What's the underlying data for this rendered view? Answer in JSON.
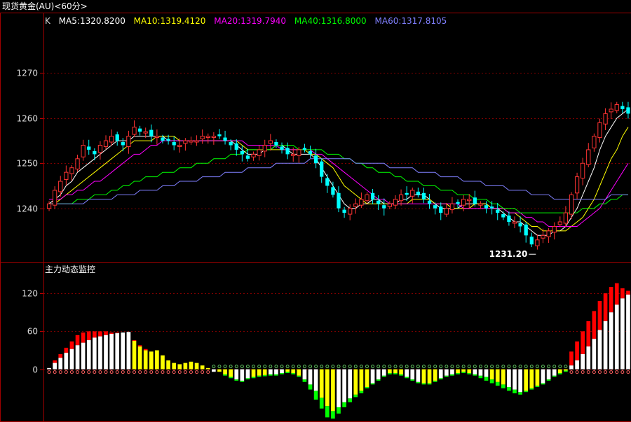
{
  "title": "现货黄金(AU)<60分>",
  "ma_legend": {
    "k_label": "K",
    "items": [
      {
        "label": "MA5:1320.8200",
        "color": "#ffffff"
      },
      {
        "label": "MA10:1319.4120",
        "color": "#ffff00"
      },
      {
        "label": "MA20:1319.7940",
        "color": "#ff00ff"
      },
      {
        "label": "MA40:1316.8000",
        "color": "#00ff00"
      },
      {
        "label": "MA60:1317.8105",
        "color": "#8080ff"
      }
    ]
  },
  "sub_title": "主力动态监控",
  "colors": {
    "up": "#ff3333",
    "down": "#00ffff",
    "frame": "#a00000",
    "grid": "#800000",
    "red_bar": "#ff0000",
    "white_bar": "#ffffff",
    "yellow_bar": "#ffff00",
    "green_bar": "#00ff00"
  },
  "chart_data": [
    {
      "type": "candlestick",
      "ylim": [
        1228,
        1280
      ],
      "yticks": [
        1240,
        1250,
        1260,
        1270
      ],
      "annotation": "1231.20",
      "closes": [
        1241,
        1244,
        1246,
        1248,
        1249,
        1251,
        1254,
        1253,
        1252,
        1254,
        1255,
        1256,
        1255,
        1254,
        1256,
        1258,
        1257,
        1257,
        1256,
        1256,
        1255,
        1255,
        1254,
        1254,
        1255,
        1255,
        1255,
        1256,
        1256,
        1256,
        1256,
        1255,
        1254,
        1253,
        1252,
        1251,
        1252,
        1253,
        1254,
        1255,
        1254,
        1253,
        1252,
        1252,
        1253,
        1253,
        1252,
        1250,
        1247,
        1245,
        1243,
        1240,
        1239,
        1240,
        1241,
        1242,
        1243,
        1242,
        1241,
        1240,
        1241,
        1242,
        1243,
        1243,
        1244,
        1243,
        1242,
        1241,
        1240,
        1239,
        1240,
        1241,
        1241,
        1242,
        1242,
        1241,
        1241,
        1240,
        1240,
        1239,
        1238,
        1237,
        1237,
        1236,
        1234,
        1232,
        1233,
        1234,
        1235,
        1236,
        1237,
        1239,
        1243,
        1247,
        1250,
        1253,
        1256,
        1259,
        1261,
        1262,
        1263,
        1262,
        1261
      ],
      "series": [
        {
          "name": "MA5",
          "values": [
            1241,
            1242,
            1243,
            1245,
            1246,
            1248,
            1249,
            1250,
            1251,
            1252,
            1253,
            1254,
            1255,
            1255,
            1255,
            1256,
            1256,
            1256,
            1256,
            1256,
            1256,
            1255,
            1255,
            1255,
            1255,
            1255,
            1255,
            1255,
            1255,
            1255,
            1255,
            1255,
            1255,
            1254,
            1253,
            1252,
            1252,
            1252,
            1253,
            1253,
            1254,
            1254,
            1253,
            1252,
            1252,
            1252,
            1252,
            1251,
            1249,
            1247,
            1245,
            1243,
            1241,
            1240,
            1240,
            1241,
            1241,
            1242,
            1242,
            1241,
            1241,
            1241,
            1242,
            1242,
            1243,
            1243,
            1243,
            1242,
            1241,
            1240,
            1240,
            1240,
            1240,
            1241,
            1241,
            1241,
            1241,
            1241,
            1240,
            1240,
            1239,
            1238,
            1237,
            1237,
            1236,
            1235,
            1234,
            1234,
            1234,
            1235,
            1235,
            1236,
            1238,
            1240,
            1243,
            1246,
            1249,
            1253,
            1256,
            1258,
            1260,
            1261,
            1262
          ]
        },
        {
          "name": "MA10",
          "values": [
            1241,
            1241,
            1242,
            1243,
            1244,
            1245,
            1246,
            1247,
            1248,
            1249,
            1250,
            1251,
            1252,
            1253,
            1254,
            1255,
            1255,
            1255,
            1255,
            1256,
            1256,
            1256,
            1256,
            1255,
            1255,
            1255,
            1255,
            1255,
            1255,
            1255,
            1255,
            1255,
            1255,
            1255,
            1254,
            1253,
            1253,
            1253,
            1253,
            1253,
            1253,
            1253,
            1253,
            1253,
            1253,
            1253,
            1252,
            1252,
            1251,
            1250,
            1249,
            1247,
            1245,
            1244,
            1243,
            1242,
            1241,
            1241,
            1241,
            1241,
            1241,
            1241,
            1241,
            1241,
            1242,
            1242,
            1242,
            1242,
            1241,
            1241,
            1241,
            1240,
            1240,
            1240,
            1240,
            1241,
            1241,
            1241,
            1240,
            1240,
            1240,
            1239,
            1239,
            1238,
            1237,
            1236,
            1236,
            1235,
            1235,
            1235,
            1235,
            1235,
            1236,
            1237,
            1238,
            1240,
            1242,
            1245,
            1248,
            1251,
            1253,
            1256,
            1258
          ]
        },
        {
          "name": "MA20",
          "values": [
            1242,
            1242,
            1242,
            1243,
            1243,
            1244,
            1244,
            1245,
            1246,
            1246,
            1247,
            1248,
            1249,
            1250,
            1251,
            1252,
            1252,
            1253,
            1254,
            1254,
            1255,
            1255,
            1255,
            1255,
            1255,
            1255,
            1255,
            1255,
            1255,
            1255,
            1255,
            1255,
            1255,
            1255,
            1255,
            1254,
            1254,
            1254,
            1254,
            1254,
            1254,
            1253,
            1253,
            1253,
            1253,
            1253,
            1253,
            1252,
            1252,
            1251,
            1250,
            1249,
            1248,
            1247,
            1246,
            1245,
            1244,
            1243,
            1242,
            1242,
            1241,
            1241,
            1241,
            1241,
            1241,
            1241,
            1241,
            1241,
            1241,
            1241,
            1241,
            1241,
            1241,
            1240,
            1240,
            1240,
            1240,
            1240,
            1240,
            1240,
            1240,
            1239,
            1239,
            1239,
            1238,
            1238,
            1237,
            1237,
            1236,
            1236,
            1236,
            1236,
            1236,
            1236,
            1237,
            1238,
            1239,
            1240,
            1242,
            1244,
            1246,
            1248,
            1250
          ]
        },
        {
          "name": "MA40",
          "values": [
            1241,
            1241,
            1241,
            1241,
            1241,
            1242,
            1242,
            1242,
            1243,
            1243,
            1243,
            1244,
            1244,
            1245,
            1245,
            1246,
            1246,
            1247,
            1247,
            1247,
            1248,
            1248,
            1248,
            1249,
            1249,
            1249,
            1250,
            1250,
            1250,
            1251,
            1251,
            1251,
            1252,
            1252,
            1252,
            1253,
            1253,
            1253,
            1253,
            1253,
            1254,
            1254,
            1254,
            1254,
            1253,
            1253,
            1253,
            1253,
            1253,
            1252,
            1252,
            1252,
            1251,
            1251,
            1250,
            1250,
            1249,
            1249,
            1248,
            1248,
            1248,
            1247,
            1247,
            1246,
            1246,
            1246,
            1245,
            1245,
            1245,
            1244,
            1244,
            1244,
            1243,
            1243,
            1243,
            1242,
            1242,
            1242,
            1241,
            1241,
            1240,
            1240,
            1240,
            1239,
            1239,
            1239,
            1239,
            1239,
            1239,
            1239,
            1239,
            1239,
            1239,
            1239,
            1240,
            1240,
            1240,
            1241,
            1241,
            1242,
            1242,
            1243,
            1243
          ]
        },
        {
          "name": "MA60",
          "values": [
            1241,
            1241,
            1241,
            1241,
            1241,
            1241,
            1241,
            1242,
            1242,
            1242,
            1242,
            1242,
            1243,
            1243,
            1243,
            1243,
            1244,
            1244,
            1244,
            1244,
            1245,
            1245,
            1245,
            1246,
            1246,
            1246,
            1246,
            1247,
            1247,
            1247,
            1247,
            1248,
            1248,
            1248,
            1248,
            1249,
            1249,
            1249,
            1249,
            1249,
            1250,
            1250,
            1250,
            1250,
            1250,
            1250,
            1251,
            1251,
            1251,
            1251,
            1251,
            1251,
            1251,
            1251,
            1250,
            1250,
            1250,
            1250,
            1250,
            1250,
            1249,
            1249,
            1249,
            1249,
            1249,
            1248,
            1248,
            1248,
            1248,
            1247,
            1247,
            1247,
            1247,
            1246,
            1246,
            1246,
            1246,
            1245,
            1245,
            1245,
            1245,
            1244,
            1244,
            1244,
            1244,
            1243,
            1243,
            1243,
            1243,
            1242,
            1242,
            1242,
            1242,
            1242,
            1242,
            1242,
            1242,
            1242,
            1242,
            1243,
            1243,
            1243,
            1243
          ]
        }
      ]
    },
    {
      "type": "bar",
      "name": "主力动态监控",
      "ylim": [
        -80,
        150
      ],
      "yticks": [
        0,
        60,
        120
      ],
      "values": [
        2,
        10,
        18,
        26,
        32,
        38,
        42,
        46,
        50,
        52,
        54,
        56,
        57,
        58,
        59,
        45,
        36,
        30,
        28,
        30,
        22,
        14,
        10,
        8,
        10,
        12,
        10,
        6,
        2,
        -4,
        -4,
        -8,
        -12,
        -16,
        -18,
        -14,
        -12,
        -10,
        -9,
        -8,
        -8,
        -6,
        -4,
        -6,
        -10,
        -16,
        -24,
        -34,
        -45,
        -58,
        -66,
        -60,
        -52,
        -46,
        -40,
        -34,
        -28,
        -22,
        -16,
        -10,
        -6,
        -6,
        -8,
        -12,
        -16,
        -20,
        -22,
        -22,
        -18,
        -14,
        -10,
        -8,
        -6,
        -4,
        -6,
        -8,
        -10,
        -12,
        -16,
        -20,
        -24,
        -28,
        -32,
        -36,
        -34,
        -30,
        -26,
        -22,
        -16,
        -10,
        -6,
        -2,
        6,
        14,
        24,
        36,
        48,
        62,
        76,
        90,
        102,
        112,
        118
      ],
      "upper": [
        2,
        14,
        24,
        34,
        44,
        54,
        58,
        60,
        60,
        60,
        60,
        58,
        58,
        58,
        59,
        46,
        38,
        32,
        28,
        30,
        22,
        14,
        10,
        8,
        10,
        12,
        10,
        6,
        2,
        -4,
        -4,
        -8,
        -12,
        -16,
        -18,
        -14,
        -12,
        -10,
        -9,
        -8,
        -8,
        -6,
        -4,
        -6,
        -10,
        -16,
        -24,
        -34,
        -45,
        -58,
        -66,
        -60,
        -52,
        -46,
        -40,
        -34,
        -28,
        -22,
        -16,
        -10,
        -6,
        -6,
        -8,
        -12,
        -16,
        -20,
        -22,
        -22,
        -18,
        -14,
        -10,
        -8,
        -6,
        -4,
        -6,
        -8,
        -10,
        -12,
        -16,
        -20,
        -24,
        -28,
        -32,
        -36,
        -34,
        -30,
        -26,
        -22,
        -16,
        -10,
        -6,
        -2,
        28,
        44,
        60,
        76,
        92,
        108,
        120,
        130,
        136,
        128,
        124
      ],
      "lower_green": [
        0,
        0,
        0,
        0,
        0,
        0,
        0,
        0,
        0,
        0,
        0,
        0,
        0,
        0,
        0,
        0,
        0,
        0,
        0,
        0,
        0,
        0,
        0,
        0,
        0,
        0,
        0,
        0,
        0,
        0,
        0,
        -10,
        -14,
        -18,
        -20,
        -16,
        -14,
        -12,
        -11,
        -10,
        -10,
        -8,
        -6,
        -8,
        -12,
        -20,
        -32,
        -48,
        -62,
        -76,
        -78,
        -70,
        -60,
        -52,
        -44,
        -38,
        -30,
        -24,
        -18,
        -12,
        -8,
        -8,
        -10,
        -14,
        -18,
        -22,
        -24,
        -24,
        -20,
        -16,
        -12,
        -10,
        -8,
        -6,
        -8,
        -10,
        -14,
        -18,
        -22,
        -26,
        -30,
        -34,
        -38,
        -40,
        -36,
        -32,
        -28,
        -24,
        -18,
        -12,
        -8,
        -4,
        0,
        0,
        0,
        0,
        0,
        0,
        0,
        0,
        0,
        0,
        0
      ]
    }
  ]
}
